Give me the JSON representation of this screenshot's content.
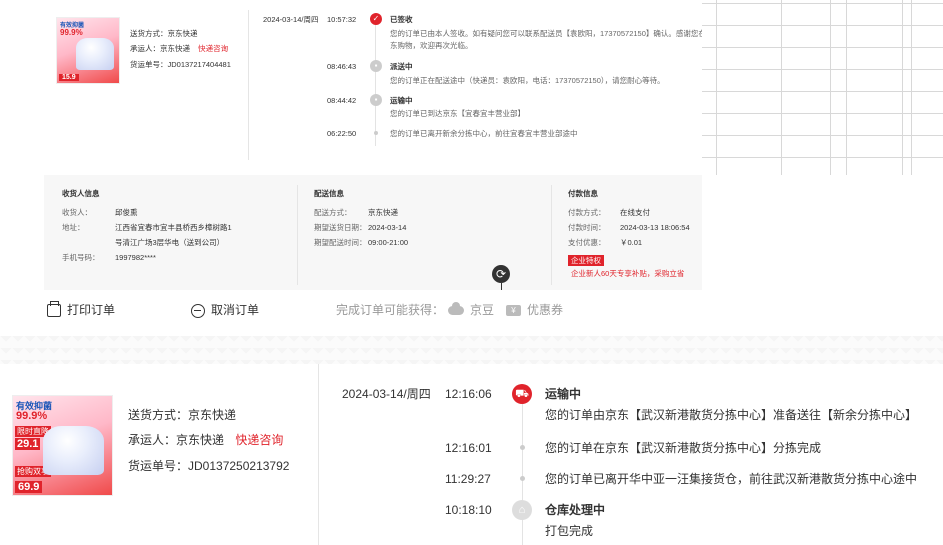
{
  "top_order": {
    "delivery_method_label": "送货方式：",
    "delivery_method": "京东快递",
    "carrier_label": "承运人：",
    "carrier": "京东快递",
    "carrier_link": "快递咨询",
    "waybill_label": "货运单号：",
    "waybill": "JD0137217404481",
    "product_img": {
      "brand": "有效抑菌",
      "pct": "99.9%",
      "price": "15.9"
    },
    "date": "2024-03-14/周四",
    "tracking": [
      {
        "time": "10:57:32",
        "status": "已签收",
        "desc": "您的订单已由本人签收。如有疑问您可以联系配送员【袁欧阳，17370572150】确认。感谢您在京",
        "desc2": "东购物，欢迎再次光临。"
      },
      {
        "time": "08:46:43",
        "status": "派送中",
        "desc": "您的订单正在配送途中（快递员：袁欧阳，电话：17370572150），请您耐心等待。"
      },
      {
        "time": "08:44:42",
        "status": "运输中",
        "desc": "您的订单已到达京东【宜春宜丰营业部】"
      },
      {
        "time": "06:22:50",
        "status": "",
        "desc": "您的订单已离开新余分拣中心，前往宜春宜丰营业部途中"
      }
    ]
  },
  "info": {
    "receiver": {
      "title": "收货人信息",
      "name_label": "收货人：",
      "name": "邱俊熏",
      "addr_label": "地址：",
      "addr1": "江西省宜春市宜丰县桥西乡樟树路1",
      "addr2": "号清江广场3层华电（送到公司）",
      "phone_label": "手机号码：",
      "phone": "1997982****"
    },
    "delivery": {
      "title": "配送信息",
      "method_label": "配送方式：",
      "method": "京东快递",
      "date_label": "期望送货日期：",
      "date": "2024-03-14",
      "time_label": "期望配送时间：",
      "time": "09:00-21:00"
    },
    "payment": {
      "title": "付款信息",
      "method_label": "付款方式：",
      "method": "在线支付",
      "time_label": "付款时间：",
      "time": "2024-03-13 18:06:54",
      "discount_label": "支付优惠：",
      "discount": "￥0.01",
      "badge": "企业特权",
      "promo": "企业新人60天专享补贴，采购立省"
    }
  },
  "actions": {
    "print": "打印订单",
    "cancel": "取消订单",
    "earn_label": "完成订单可能获得：",
    "jd_bean": "京豆",
    "coupon": "优惠券"
  },
  "bottom_order": {
    "delivery_method_label": "送货方式：",
    "delivery_method": "京东快递",
    "carrier_label": "承运人：",
    "carrier": "京东快递",
    "carrier_link": "快递咨询",
    "waybill_label": "货运单号：",
    "waybill": "JD0137250213792",
    "product_img": {
      "brand": "有效抑菌",
      "pct": "99.9%",
      "price": "69.9",
      "tag": "限时直降",
      "tag2": "29.1",
      "tag3": "抢购双享"
    },
    "date": "2024-03-14/周四",
    "tracking": [
      {
        "time": "12:16:06",
        "status": "运输中",
        "desc": "您的订单由京东【武汉新港散货分拣中心】准备送往【新余分拣中心】"
      },
      {
        "time": "12:16:01",
        "status": "",
        "desc": "您的订单在京东【武汉新港散货分拣中心】分拣完成"
      },
      {
        "time": "11:29:27",
        "status": "",
        "desc": "您的订单已离开华中亚一汪集接货仓，前往武汉新港散货分拣中心途中"
      },
      {
        "time": "10:18:10",
        "status": "仓库处理中",
        "desc": "打包完成"
      }
    ]
  },
  "colors": {
    "accent": "#e0232b",
    "muted": "#999999",
    "info_bg": "#f7f7f7"
  },
  "icons": [
    "check-icon",
    "truck-icon",
    "printer-icon",
    "minus-circle-icon",
    "cloud-icon",
    "ticket-icon",
    "warehouse-icon",
    "refresh-cursor-icon"
  ]
}
